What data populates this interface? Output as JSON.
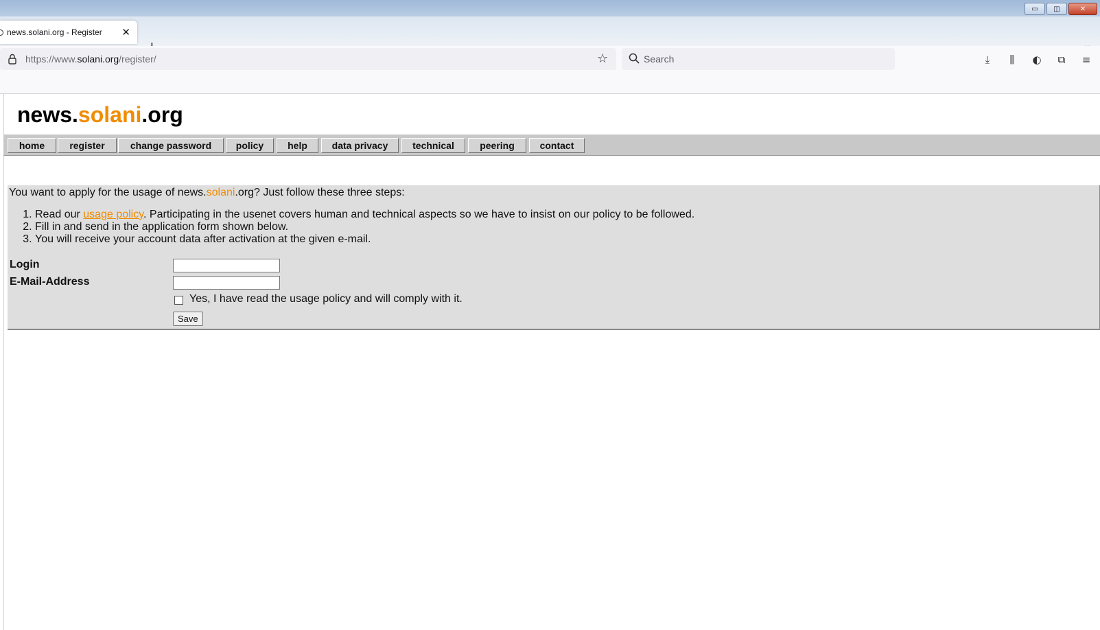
{
  "browser": {
    "tab_title": "news.solani.org - Register",
    "new_tab_symbol": "+",
    "url_prefix": "https://www.",
    "url_host": "solani.org",
    "url_path": "/register/",
    "search_placeholder": "Search"
  },
  "site": {
    "logo_part1": "news.",
    "logo_part2": "solani",
    "logo_part3": ".org",
    "accent_color": "#f08c00"
  },
  "menu": {
    "items": [
      {
        "label": "home"
      },
      {
        "label": "register"
      },
      {
        "label": "change password"
      },
      {
        "label": "policy"
      },
      {
        "label": "help"
      },
      {
        "label": "data privacy"
      },
      {
        "label": "technical"
      },
      {
        "label": "peering"
      },
      {
        "label": "contact"
      }
    ]
  },
  "main": {
    "intro_before": "You want to apply for the usage of news.",
    "intro_accent": "solani",
    "intro_after": ".org? Just follow these three steps:",
    "step1_before": "Read our ",
    "step1_link": "usage policy",
    "step1_after": ". Participating in the usenet covers human and technical aspects so we have to insist on our policy to be followed.",
    "step2": "Fill in and send in the application form shown below.",
    "step3": "You will receive your account data after activation at the given e-mail."
  },
  "form": {
    "login_label": "Login",
    "login_value": "",
    "email_label": "E-Mail-Address",
    "email_value": "",
    "agree_label": "Yes, I have read the usage policy and will comply with it.",
    "agree_checked": false,
    "save_label": "Save"
  }
}
